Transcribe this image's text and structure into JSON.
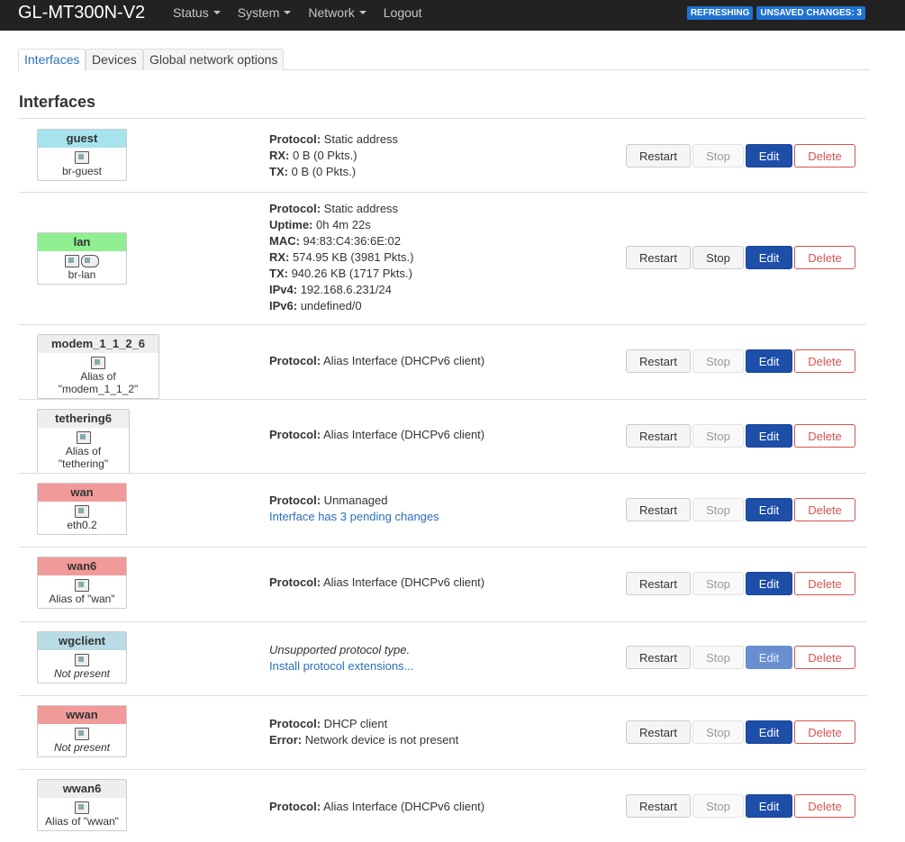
{
  "header": {
    "brand": "GL-MT300N-V2",
    "menu": [
      {
        "label": "Status",
        "caret": true
      },
      {
        "label": "System",
        "caret": true
      },
      {
        "label": "Network",
        "caret": true
      },
      {
        "label": "Logout",
        "caret": false
      }
    ],
    "badges": {
      "refreshing": "REFRESHING",
      "unsaved": "UNSAVED CHANGES: 3"
    }
  },
  "tabs": [
    {
      "label": "Interfaces",
      "active": true
    },
    {
      "label": "Devices",
      "active": false
    },
    {
      "label": "Global network options",
      "active": false
    }
  ],
  "section_title": "Interfaces",
  "buttons": {
    "restart": "Restart",
    "stop": "Stop",
    "edit": "Edit",
    "delete": "Delete"
  },
  "colors": {
    "guest": "#a7e3ec",
    "lan": "#90ef90",
    "alias": "#eeeeee",
    "wan": "#f19a9a",
    "wgclient": "#b9dbe4"
  },
  "interfaces": [
    {
      "name": "guest",
      "device": "br-guest",
      "icons": [
        "bridge-icon"
      ],
      "info": [
        {
          "label": "Protocol:",
          "value": " Static address"
        },
        {
          "label": "RX:",
          "value": " 0 B (0 Pkts.)"
        },
        {
          "label": "TX:",
          "value": " 0 B (0 Pkts.)"
        }
      ]
    },
    {
      "name": "lan",
      "device": "br-lan",
      "icons": [
        "bridge-icon",
        "wifi-icon"
      ],
      "info": [
        {
          "label": "Protocol:",
          "value": " Static address"
        },
        {
          "label": "Uptime:",
          "value": " 0h 4m 22s"
        },
        {
          "label": "MAC:",
          "value": " 94:83:C4:36:6E:02"
        },
        {
          "label": "RX:",
          "value": " 574.95 KB (3981 Pkts.)"
        },
        {
          "label": "TX:",
          "value": " 940.26 KB (1717 Pkts.)"
        },
        {
          "label": "IPv4:",
          "value": " 192.168.6.231/24"
        },
        {
          "label": "IPv6:",
          "value": " undefined/0"
        }
      ]
    },
    {
      "name": "modem_1_1_2_6",
      "device": "Alias of \"modem_1_1_2\"",
      "icons": [
        "alias-icon"
      ],
      "info": [
        {
          "label": "Protocol:",
          "value": " Alias Interface (DHCPv6 client)"
        }
      ]
    },
    {
      "name": "tethering6",
      "device": "Alias of \"tethering\"",
      "icons": [
        "alias-icon"
      ],
      "info": [
        {
          "label": "Protocol:",
          "value": " Alias Interface (DHCPv6 client)"
        }
      ]
    },
    {
      "name": "wan",
      "device": "eth0.2",
      "icons": [
        "ethernet-icon"
      ],
      "info": [
        {
          "label": "Protocol:",
          "value": " Unmanaged"
        },
        {
          "link": "Interface has 3 pending changes"
        }
      ]
    },
    {
      "name": "wan6",
      "device": "Alias of \"wan\"",
      "icons": [
        "alias-icon"
      ],
      "info": [
        {
          "label": "Protocol:",
          "value": " Alias Interface (DHCPv6 client)"
        }
      ]
    },
    {
      "name": "wgclient",
      "device": "Not present",
      "icons": [
        "alias-icon"
      ],
      "info": [
        {
          "italic": "Unsupported protocol type."
        },
        {
          "link": "Install protocol extensions..."
        }
      ]
    },
    {
      "name": "wwan",
      "device": "Not present",
      "icons": [
        "alias-icon"
      ],
      "info": [
        {
          "label": "Protocol:",
          "value": " DHCP client"
        },
        {
          "label": "Error:",
          "value": " Network device is not present"
        }
      ]
    },
    {
      "name": "wwan6",
      "device": "Alias of \"wwan\"",
      "icons": [
        "alias-icon"
      ],
      "info": [
        {
          "label": "Protocol:",
          "value": " Alias Interface (DHCPv6 client)"
        }
      ]
    }
  ]
}
